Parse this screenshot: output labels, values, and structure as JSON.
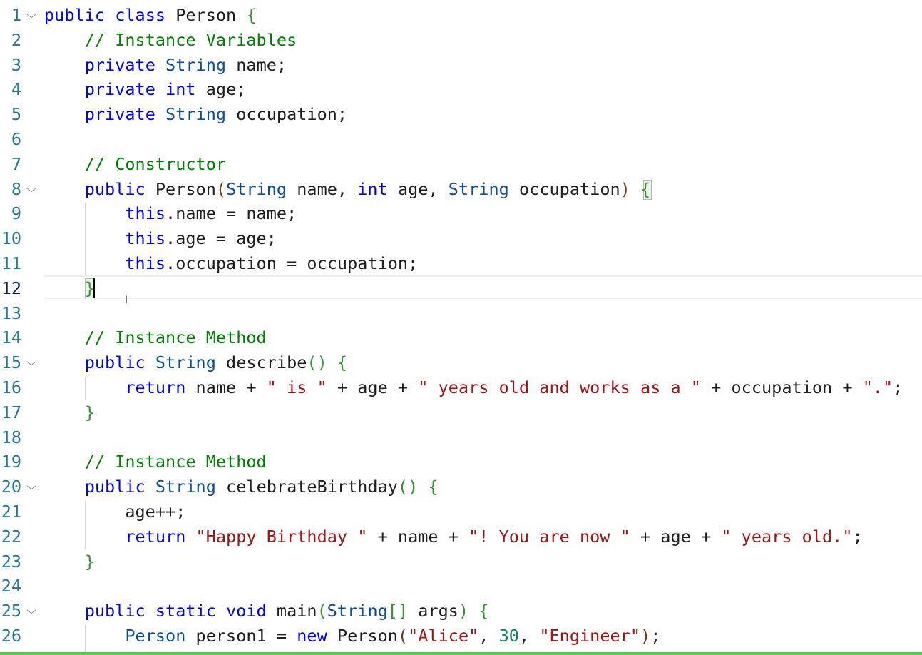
{
  "editor": {
    "language": "java",
    "active_line": 12,
    "lines": [
      {
        "no": "1",
        "fold": true,
        "tokens": [
          {
            "t": "public",
            "c": "kw"
          },
          {
            "t": " "
          },
          {
            "t": "class",
            "c": "kw"
          },
          {
            "t": " Person "
          },
          {
            "t": "{",
            "c": "brk"
          }
        ]
      },
      {
        "no": "2",
        "tokens": [
          {
            "t": "    "
          },
          {
            "t": "// Instance Variables",
            "c": "com"
          }
        ]
      },
      {
        "no": "3",
        "tokens": [
          {
            "t": "    "
          },
          {
            "t": "private",
            "c": "kw"
          },
          {
            "t": " "
          },
          {
            "t": "String",
            "c": "type"
          },
          {
            "t": " name;"
          }
        ]
      },
      {
        "no": "4",
        "tokens": [
          {
            "t": "    "
          },
          {
            "t": "private",
            "c": "kw"
          },
          {
            "t": " "
          },
          {
            "t": "int",
            "c": "kw"
          },
          {
            "t": " age;"
          }
        ]
      },
      {
        "no": "5",
        "tokens": [
          {
            "t": "    "
          },
          {
            "t": "private",
            "c": "kw"
          },
          {
            "t": " "
          },
          {
            "t": "String",
            "c": "type"
          },
          {
            "t": " occupation;"
          }
        ]
      },
      {
        "no": "6",
        "tokens": []
      },
      {
        "no": "7",
        "tokens": [
          {
            "t": "    "
          },
          {
            "t": "// Constructor",
            "c": "com"
          }
        ]
      },
      {
        "no": "8",
        "fold": true,
        "tokens": [
          {
            "t": "    "
          },
          {
            "t": "public",
            "c": "kw"
          },
          {
            "t": " Person"
          },
          {
            "t": "(",
            "c": "brk2"
          },
          {
            "t": "String",
            "c": "type"
          },
          {
            "t": " name, "
          },
          {
            "t": "int",
            "c": "kw"
          },
          {
            "t": " age, "
          },
          {
            "t": "String",
            "c": "type"
          },
          {
            "t": " occupation"
          },
          {
            "t": ")",
            "c": "brk2"
          },
          {
            "t": " "
          },
          {
            "t": "{",
            "c": "brk"
          }
        ]
      },
      {
        "no": "9",
        "tokens": [
          {
            "t": "        "
          },
          {
            "t": "this",
            "c": "kw"
          },
          {
            "t": ".name = name;"
          }
        ]
      },
      {
        "no": "10",
        "tokens": [
          {
            "t": "        "
          },
          {
            "t": "this",
            "c": "kw"
          },
          {
            "t": ".age = age;"
          }
        ]
      },
      {
        "no": "11",
        "tokens": [
          {
            "t": "        "
          },
          {
            "t": "this",
            "c": "kw"
          },
          {
            "t": ".occupation = occupation;"
          }
        ]
      },
      {
        "no": "12",
        "tokens": [
          {
            "t": "    "
          },
          {
            "t": "}",
            "c": "brk"
          }
        ]
      },
      {
        "no": "13",
        "tokens": []
      },
      {
        "no": "14",
        "tokens": [
          {
            "t": "    "
          },
          {
            "t": "// Instance Method",
            "c": "com"
          }
        ]
      },
      {
        "no": "15",
        "fold": true,
        "tokens": [
          {
            "t": "    "
          },
          {
            "t": "public",
            "c": "kw"
          },
          {
            "t": " "
          },
          {
            "t": "String",
            "c": "type"
          },
          {
            "t": " describe"
          },
          {
            "t": "()",
            "c": "brk"
          },
          {
            "t": " "
          },
          {
            "t": "{",
            "c": "brk"
          }
        ]
      },
      {
        "no": "16",
        "tokens": [
          {
            "t": "        "
          },
          {
            "t": "return",
            "c": "kw"
          },
          {
            "t": " name + "
          },
          {
            "t": "\" is \"",
            "c": "str"
          },
          {
            "t": " + age + "
          },
          {
            "t": "\" years old and works as a \"",
            "c": "str"
          },
          {
            "t": " + occupation + "
          },
          {
            "t": "\".\"",
            "c": "str"
          },
          {
            "t": ";"
          }
        ]
      },
      {
        "no": "17",
        "tokens": [
          {
            "t": "    "
          },
          {
            "t": "}",
            "c": "brk"
          }
        ]
      },
      {
        "no": "18",
        "tokens": []
      },
      {
        "no": "19",
        "tokens": [
          {
            "t": "    "
          },
          {
            "t": "// Instance Method",
            "c": "com"
          }
        ]
      },
      {
        "no": "20",
        "fold": true,
        "tokens": [
          {
            "t": "    "
          },
          {
            "t": "public",
            "c": "kw"
          },
          {
            "t": " "
          },
          {
            "t": "String",
            "c": "type"
          },
          {
            "t": " celebrateBirthday"
          },
          {
            "t": "()",
            "c": "brk"
          },
          {
            "t": " "
          },
          {
            "t": "{",
            "c": "brk"
          }
        ]
      },
      {
        "no": "21",
        "tokens": [
          {
            "t": "        age++;"
          }
        ]
      },
      {
        "no": "22",
        "tokens": [
          {
            "t": "        "
          },
          {
            "t": "return",
            "c": "kw"
          },
          {
            "t": " "
          },
          {
            "t": "\"Happy Birthday \"",
            "c": "str"
          },
          {
            "t": " + name + "
          },
          {
            "t": "\"! You are now \"",
            "c": "str"
          },
          {
            "t": " + age + "
          },
          {
            "t": "\" years old.\"",
            "c": "str"
          },
          {
            "t": ";"
          }
        ]
      },
      {
        "no": "23",
        "tokens": [
          {
            "t": "    "
          },
          {
            "t": "}",
            "c": "brk"
          }
        ]
      },
      {
        "no": "24",
        "tokens": []
      },
      {
        "no": "25",
        "fold": true,
        "tokens": [
          {
            "t": "    "
          },
          {
            "t": "public",
            "c": "kw"
          },
          {
            "t": " "
          },
          {
            "t": "static",
            "c": "kw"
          },
          {
            "t": " "
          },
          {
            "t": "void",
            "c": "kw"
          },
          {
            "t": " main"
          },
          {
            "t": "(",
            "c": "brk"
          },
          {
            "t": "String",
            "c": "type"
          },
          {
            "t": "[]",
            "c": "brk"
          },
          {
            "t": " args"
          },
          {
            "t": ")",
            "c": "brk"
          },
          {
            "t": " "
          },
          {
            "t": "{",
            "c": "brk"
          }
        ]
      },
      {
        "no": "26",
        "tokens": [
          {
            "t": "        "
          },
          {
            "t": "Person",
            "c": "type"
          },
          {
            "t": " person1 = "
          },
          {
            "t": "new",
            "c": "kw"
          },
          {
            "t": " Person"
          },
          {
            "t": "(",
            "c": "brk2"
          },
          {
            "t": "\"Alice\"",
            "c": "str"
          },
          {
            "t": ", "
          },
          {
            "t": "30",
            "c": "num"
          },
          {
            "t": ", "
          },
          {
            "t": "\"Engineer\"",
            "c": "str"
          },
          {
            "t": ")",
            "c": "brk2"
          },
          {
            "t": ";"
          }
        ]
      }
    ]
  },
  "colors": {
    "keyword": "#0000ff",
    "type": "#0a4ea3",
    "string": "#a31515",
    "comment": "#008000",
    "number": "#098658",
    "bracket": "#319331",
    "line_number": "#237893",
    "active_line_number": "#0b216f",
    "bottom_border": "#4ec94e"
  },
  "icons": {
    "fold": "chevron-down-icon",
    "mouse_cursor": "text-cursor-icon"
  }
}
